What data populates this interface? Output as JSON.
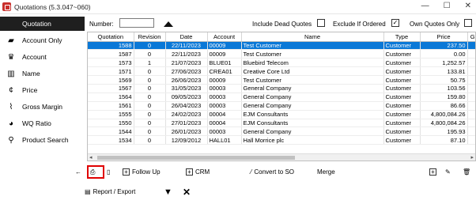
{
  "window": {
    "title": "Quotations (5.3.047~060)",
    "controls": [
      "—",
      "☐",
      "✕"
    ]
  },
  "sidebar": {
    "items": [
      {
        "label": "Quotation",
        "icon": "",
        "active": true
      },
      {
        "label": "Account Only",
        "icon": "folder-icon"
      },
      {
        "label": "Account",
        "icon": "crown-icon"
      },
      {
        "label": "Name",
        "icon": "piano-icon"
      },
      {
        "label": "Price",
        "icon": "currency-icon"
      },
      {
        "label": "Gross Margin",
        "icon": "pulse-icon"
      },
      {
        "label": "WQ Ratio",
        "icon": "pie-icon"
      },
      {
        "label": "Product Search",
        "icon": "search-icon"
      }
    ]
  },
  "filters": {
    "number_label": "Number:",
    "number_value": "",
    "include_dead_label": "Include Dead Quotes",
    "include_dead_checked": false,
    "exclude_ordered_label": "Exclude If Ordered",
    "exclude_ordered_checked": true,
    "own_quotes_label": "Own Quotes Only",
    "own_quotes_checked": false
  },
  "table": {
    "columns": [
      "Quotation",
      "Revision",
      "Date",
      "Account",
      "Name",
      "Type",
      "Price",
      "Gro"
    ],
    "rows": [
      [
        "1588",
        "0",
        "22/11/2023",
        "00009",
        "Test Customer",
        "Customer",
        "237.50",
        ""
      ],
      [
        "1587",
        "0",
        "22/11/2023",
        "00009",
        "Test Customer",
        "Customer",
        "0.00",
        ""
      ],
      [
        "1573",
        "1",
        "21/07/2023",
        "BLUE01",
        "Bluebird Telecom",
        "Customer",
        "1,252.57",
        ""
      ],
      [
        "1571",
        "0",
        "27/06/2023",
        "CREA01",
        "Creative Core Ltd",
        "Customer",
        "133.81",
        ""
      ],
      [
        "1569",
        "0",
        "26/06/2023",
        "00009",
        "Test Customer",
        "Customer",
        "50.75",
        ""
      ],
      [
        "1567",
        "0",
        "31/05/2023",
        "00003",
        "General Company",
        "Customer",
        "103.56",
        ""
      ],
      [
        "1564",
        "0",
        "09/05/2023",
        "00003",
        "General Company",
        "Customer",
        "159.80",
        ""
      ],
      [
        "1561",
        "0",
        "26/04/2023",
        "00003",
        "General Company",
        "Customer",
        "86.66",
        ""
      ],
      [
        "1555",
        "0",
        "24/02/2023",
        "00004",
        "EJM Consultants",
        "Customer",
        "4,800,084.26",
        ""
      ],
      [
        "1550",
        "0",
        "27/01/2023",
        "00004",
        "EJM Consultants",
        "Customer",
        "4,800,084.26",
        ""
      ],
      [
        "1544",
        "0",
        "26/01/2023",
        "00003",
        "General Company",
        "Customer",
        "195.93",
        ""
      ],
      [
        "1534",
        "0",
        "12/09/2012",
        "HALL01",
        "Hall Morrice plc",
        "Customer",
        "87.10",
        ""
      ]
    ],
    "selected_row": 0
  },
  "toolbar": {
    "follow_up": "Follow Up",
    "crm": "CRM",
    "convert": "Convert to SO",
    "merge": "Merge",
    "report": "Report / Export"
  },
  "colors": {
    "selection": "#0a78d7",
    "highlight": "#e00000",
    "sidebar_active": "#1f1f1f"
  }
}
